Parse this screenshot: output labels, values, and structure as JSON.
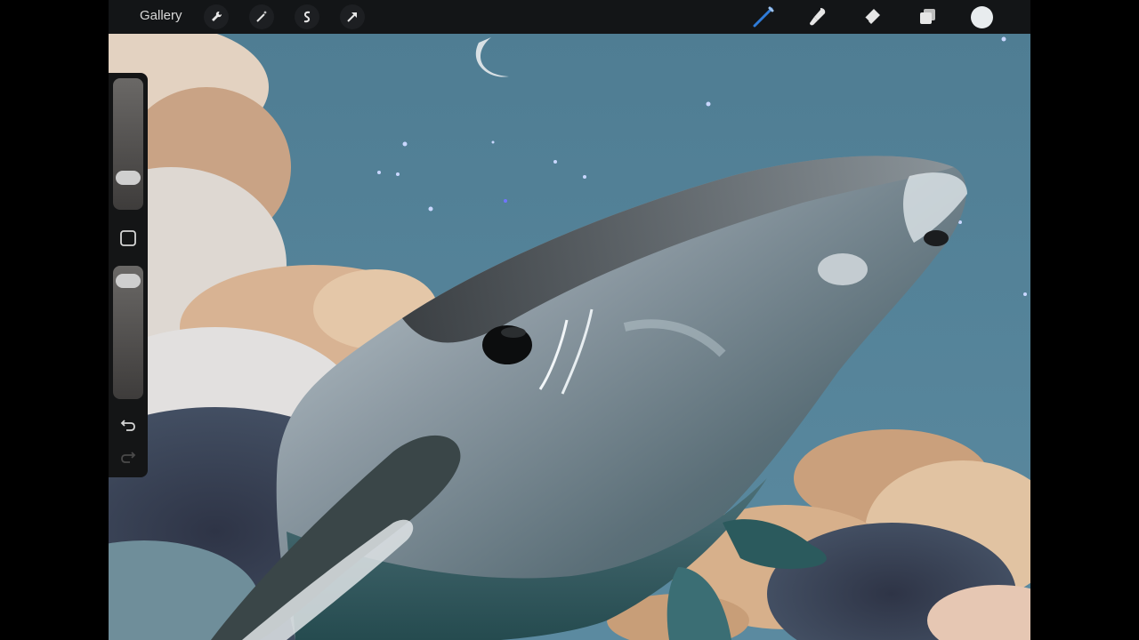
{
  "toolbar": {
    "gallery_label": "Gallery",
    "left_tools": [
      {
        "name": "wrench-icon"
      },
      {
        "name": "magic-wand-icon"
      },
      {
        "name": "selection-icon"
      },
      {
        "name": "transform-arrow-icon"
      }
    ],
    "right_tools": [
      {
        "name": "brush-icon"
      },
      {
        "name": "smudge-icon"
      },
      {
        "name": "eraser-icon"
      },
      {
        "name": "layers-icon"
      }
    ],
    "current_color": "#e8ecee",
    "active_tool_color": "#2f7bd8"
  },
  "sidebar": {
    "brush_size_level": 0.2,
    "opacity_level": 0.95,
    "modify_button": "square-icon",
    "undo": "undo-icon",
    "redo": "redo-icon"
  },
  "canvas": {
    "sky_color": "#4e7b90",
    "subject": "humpback-whale-painting"
  }
}
